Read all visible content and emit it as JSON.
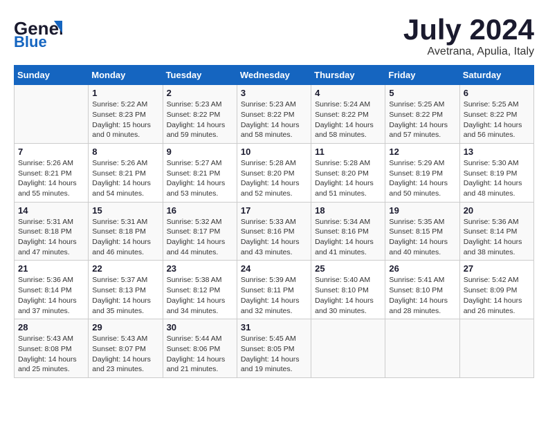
{
  "logo": {
    "general": "General",
    "blue": "Blue"
  },
  "header": {
    "month": "July 2024",
    "location": "Avetrana, Apulia, Italy"
  },
  "weekdays": [
    "Sunday",
    "Monday",
    "Tuesday",
    "Wednesday",
    "Thursday",
    "Friday",
    "Saturday"
  ],
  "weeks": [
    [
      {
        "day": "",
        "sunrise": "",
        "sunset": "",
        "daylight": ""
      },
      {
        "day": "1",
        "sunrise": "Sunrise: 5:22 AM",
        "sunset": "Sunset: 8:23 PM",
        "daylight": "Daylight: 15 hours and 0 minutes."
      },
      {
        "day": "2",
        "sunrise": "Sunrise: 5:23 AM",
        "sunset": "Sunset: 8:22 PM",
        "daylight": "Daylight: 14 hours and 59 minutes."
      },
      {
        "day": "3",
        "sunrise": "Sunrise: 5:23 AM",
        "sunset": "Sunset: 8:22 PM",
        "daylight": "Daylight: 14 hours and 58 minutes."
      },
      {
        "day": "4",
        "sunrise": "Sunrise: 5:24 AM",
        "sunset": "Sunset: 8:22 PM",
        "daylight": "Daylight: 14 hours and 58 minutes."
      },
      {
        "day": "5",
        "sunrise": "Sunrise: 5:25 AM",
        "sunset": "Sunset: 8:22 PM",
        "daylight": "Daylight: 14 hours and 57 minutes."
      },
      {
        "day": "6",
        "sunrise": "Sunrise: 5:25 AM",
        "sunset": "Sunset: 8:22 PM",
        "daylight": "Daylight: 14 hours and 56 minutes."
      }
    ],
    [
      {
        "day": "7",
        "sunrise": "Sunrise: 5:26 AM",
        "sunset": "Sunset: 8:21 PM",
        "daylight": "Daylight: 14 hours and 55 minutes."
      },
      {
        "day": "8",
        "sunrise": "Sunrise: 5:26 AM",
        "sunset": "Sunset: 8:21 PM",
        "daylight": "Daylight: 14 hours and 54 minutes."
      },
      {
        "day": "9",
        "sunrise": "Sunrise: 5:27 AM",
        "sunset": "Sunset: 8:21 PM",
        "daylight": "Daylight: 14 hours and 53 minutes."
      },
      {
        "day": "10",
        "sunrise": "Sunrise: 5:28 AM",
        "sunset": "Sunset: 8:20 PM",
        "daylight": "Daylight: 14 hours and 52 minutes."
      },
      {
        "day": "11",
        "sunrise": "Sunrise: 5:28 AM",
        "sunset": "Sunset: 8:20 PM",
        "daylight": "Daylight: 14 hours and 51 minutes."
      },
      {
        "day": "12",
        "sunrise": "Sunrise: 5:29 AM",
        "sunset": "Sunset: 8:19 PM",
        "daylight": "Daylight: 14 hours and 50 minutes."
      },
      {
        "day": "13",
        "sunrise": "Sunrise: 5:30 AM",
        "sunset": "Sunset: 8:19 PM",
        "daylight": "Daylight: 14 hours and 48 minutes."
      }
    ],
    [
      {
        "day": "14",
        "sunrise": "Sunrise: 5:31 AM",
        "sunset": "Sunset: 8:18 PM",
        "daylight": "Daylight: 14 hours and 47 minutes."
      },
      {
        "day": "15",
        "sunrise": "Sunrise: 5:31 AM",
        "sunset": "Sunset: 8:18 PM",
        "daylight": "Daylight: 14 hours and 46 minutes."
      },
      {
        "day": "16",
        "sunrise": "Sunrise: 5:32 AM",
        "sunset": "Sunset: 8:17 PM",
        "daylight": "Daylight: 14 hours and 44 minutes."
      },
      {
        "day": "17",
        "sunrise": "Sunrise: 5:33 AM",
        "sunset": "Sunset: 8:16 PM",
        "daylight": "Daylight: 14 hours and 43 minutes."
      },
      {
        "day": "18",
        "sunrise": "Sunrise: 5:34 AM",
        "sunset": "Sunset: 8:16 PM",
        "daylight": "Daylight: 14 hours and 41 minutes."
      },
      {
        "day": "19",
        "sunrise": "Sunrise: 5:35 AM",
        "sunset": "Sunset: 8:15 PM",
        "daylight": "Daylight: 14 hours and 40 minutes."
      },
      {
        "day": "20",
        "sunrise": "Sunrise: 5:36 AM",
        "sunset": "Sunset: 8:14 PM",
        "daylight": "Daylight: 14 hours and 38 minutes."
      }
    ],
    [
      {
        "day": "21",
        "sunrise": "Sunrise: 5:36 AM",
        "sunset": "Sunset: 8:14 PM",
        "daylight": "Daylight: 14 hours and 37 minutes."
      },
      {
        "day": "22",
        "sunrise": "Sunrise: 5:37 AM",
        "sunset": "Sunset: 8:13 PM",
        "daylight": "Daylight: 14 hours and 35 minutes."
      },
      {
        "day": "23",
        "sunrise": "Sunrise: 5:38 AM",
        "sunset": "Sunset: 8:12 PM",
        "daylight": "Daylight: 14 hours and 34 minutes."
      },
      {
        "day": "24",
        "sunrise": "Sunrise: 5:39 AM",
        "sunset": "Sunset: 8:11 PM",
        "daylight": "Daylight: 14 hours and 32 minutes."
      },
      {
        "day": "25",
        "sunrise": "Sunrise: 5:40 AM",
        "sunset": "Sunset: 8:10 PM",
        "daylight": "Daylight: 14 hours and 30 minutes."
      },
      {
        "day": "26",
        "sunrise": "Sunrise: 5:41 AM",
        "sunset": "Sunset: 8:10 PM",
        "daylight": "Daylight: 14 hours and 28 minutes."
      },
      {
        "day": "27",
        "sunrise": "Sunrise: 5:42 AM",
        "sunset": "Sunset: 8:09 PM",
        "daylight": "Daylight: 14 hours and 26 minutes."
      }
    ],
    [
      {
        "day": "28",
        "sunrise": "Sunrise: 5:43 AM",
        "sunset": "Sunset: 8:08 PM",
        "daylight": "Daylight: 14 hours and 25 minutes."
      },
      {
        "day": "29",
        "sunrise": "Sunrise: 5:43 AM",
        "sunset": "Sunset: 8:07 PM",
        "daylight": "Daylight: 14 hours and 23 minutes."
      },
      {
        "day": "30",
        "sunrise": "Sunrise: 5:44 AM",
        "sunset": "Sunset: 8:06 PM",
        "daylight": "Daylight: 14 hours and 21 minutes."
      },
      {
        "day": "31",
        "sunrise": "Sunrise: 5:45 AM",
        "sunset": "Sunset: 8:05 PM",
        "daylight": "Daylight: 14 hours and 19 minutes."
      },
      {
        "day": "",
        "sunrise": "",
        "sunset": "",
        "daylight": ""
      },
      {
        "day": "",
        "sunrise": "",
        "sunset": "",
        "daylight": ""
      },
      {
        "day": "",
        "sunrise": "",
        "sunset": "",
        "daylight": ""
      }
    ]
  ]
}
